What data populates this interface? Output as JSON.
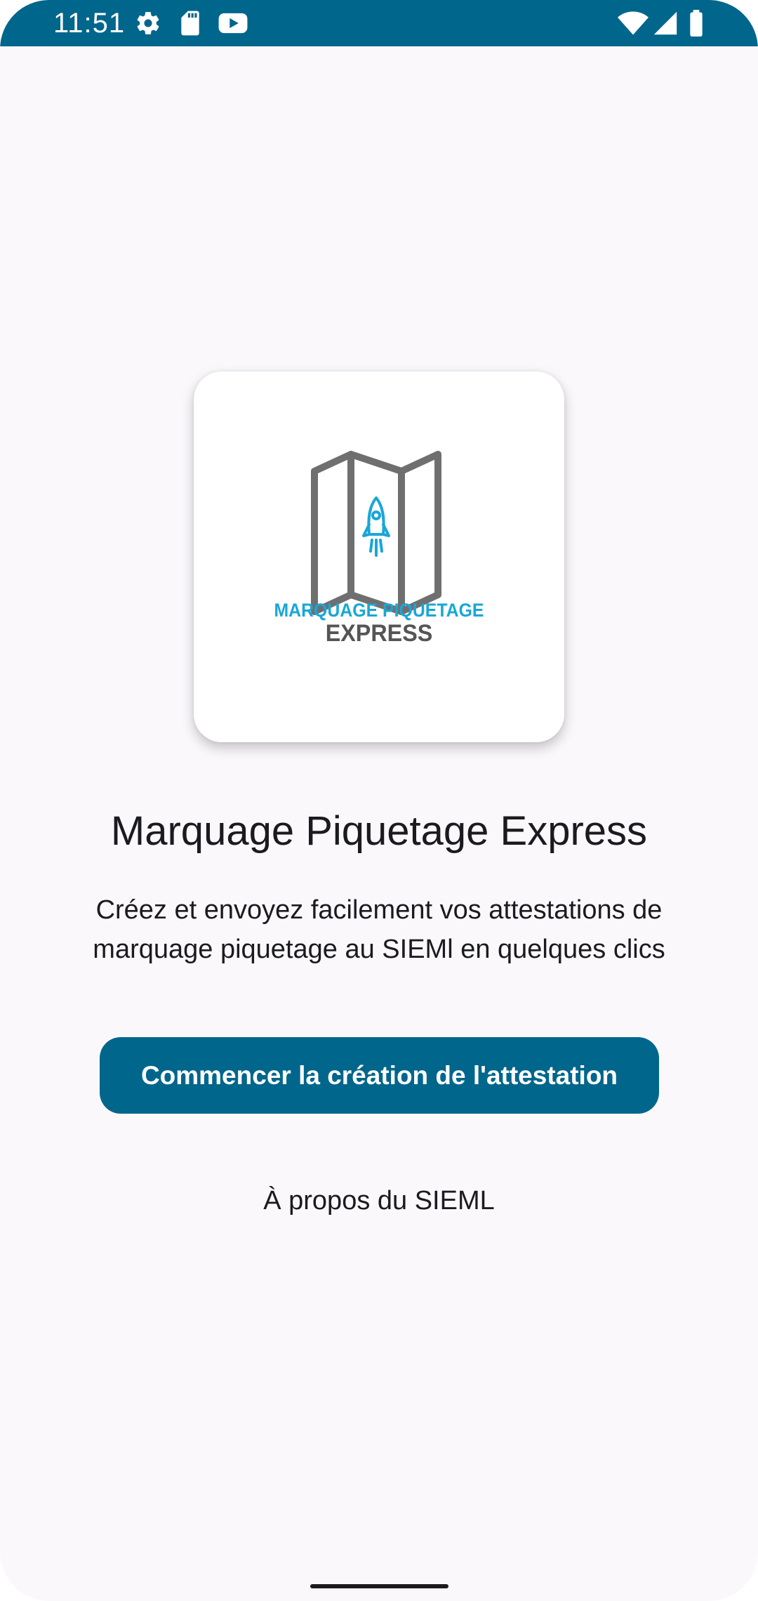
{
  "status_bar": {
    "time": "11:51",
    "icons_left": [
      "settings-gear-icon",
      "sd-card-icon",
      "youtube-icon"
    ],
    "icons_right": [
      "wifi-icon",
      "cell-signal-icon",
      "battery-icon"
    ],
    "background_color": "#00668b"
  },
  "logo": {
    "line1": "MARQUAGE PIQUETAGE",
    "line2": "EXPRESS",
    "icons": [
      "folded-map-icon",
      "rocket-icon"
    ],
    "accent_color": "#1aa6d8"
  },
  "main": {
    "title": "Marquage Piquetage Express",
    "description": "Créez et envoyez facilement vos attestations de marquage piquetage au SIEMl en quelques clics",
    "start_button_label": "Commencer la création de l'attestation",
    "about_link_label": "À propos du SIEML"
  },
  "theme": {
    "primary": "#00668b",
    "background": "#fbf8fc",
    "text": "#1b1b1f"
  }
}
